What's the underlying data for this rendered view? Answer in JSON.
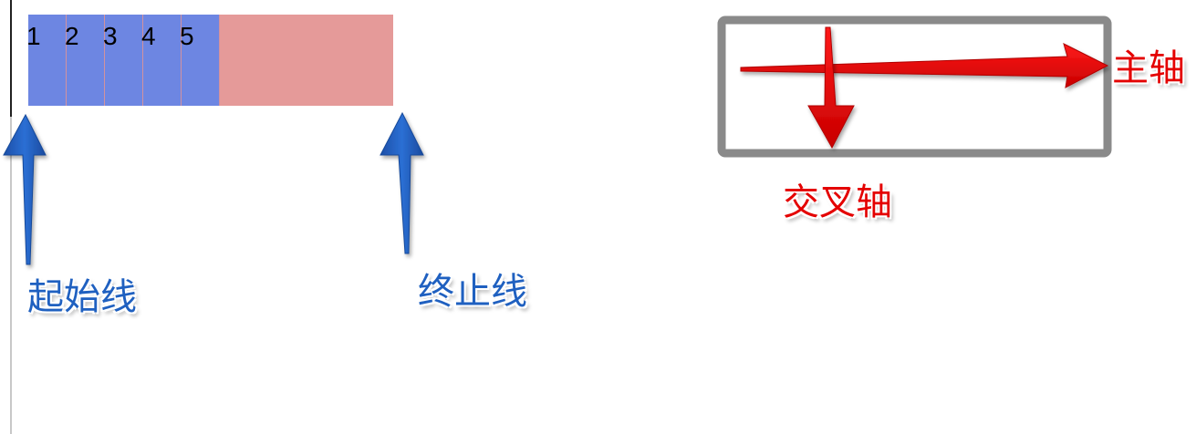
{
  "flex_items": [
    "1",
    "2",
    "3",
    "4",
    "5"
  ],
  "labels": {
    "start_line": "起始线",
    "end_line": "终止线",
    "main_axis": "主轴",
    "cross_axis": "交叉轴"
  },
  "colors": {
    "item_fill": "#6d86e2",
    "container_fill": "#e59a99",
    "blue_arrow": "#1f5fc0",
    "red_arrow": "#e40000",
    "frame_border": "#8a8a8a"
  }
}
